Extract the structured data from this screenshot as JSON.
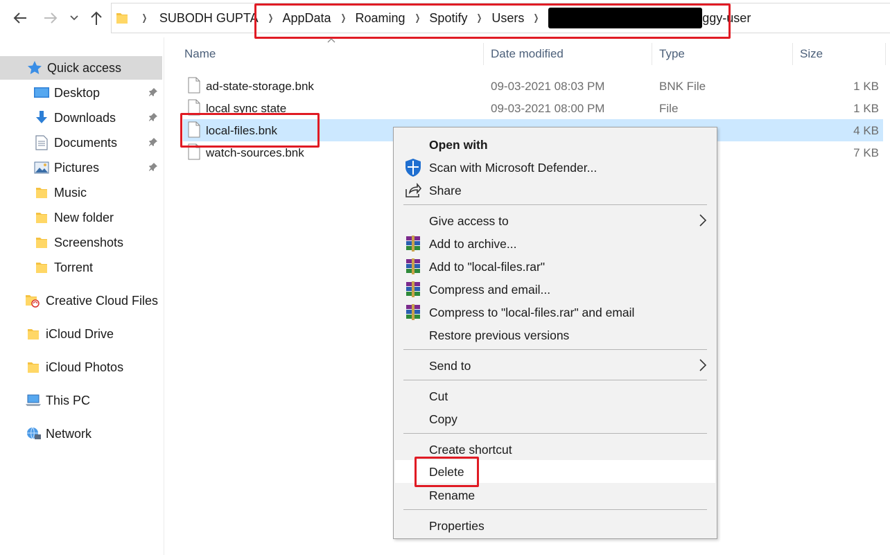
{
  "address_bar": {
    "crumbs": [
      "SUBODH GUPTA",
      "AppData",
      "Roaming",
      "Spotify",
      "Users"
    ],
    "last_crumb_visible": "ggy-user"
  },
  "sidebar": {
    "quick_access": "Quick access",
    "pinned": [
      "Desktop",
      "Downloads",
      "Documents",
      "Pictures"
    ],
    "folders": [
      "Music",
      "New folder",
      "Screenshots",
      "Torrent"
    ],
    "creative_cloud": "Creative Cloud Files",
    "icloud_drive": "iCloud Drive",
    "icloud_photos": "iCloud Photos",
    "this_pc": "This PC",
    "network": "Network"
  },
  "columns": {
    "name": "Name",
    "date": "Date modified",
    "type": "Type",
    "size": "Size"
  },
  "files": [
    {
      "name": "ad-state-storage.bnk",
      "date": "09-03-2021 08:03 PM",
      "type": "BNK File",
      "size": "1 KB"
    },
    {
      "name": "local sync state",
      "date": "09-03-2021 08:00 PM",
      "type": "File",
      "size": "1 KB"
    },
    {
      "name": "local-files.bnk",
      "date": "",
      "type": "",
      "size": "4 KB"
    },
    {
      "name": "watch-sources.bnk",
      "date": "",
      "type": "",
      "size": "7 KB"
    }
  ],
  "context_menu": {
    "open_with": "Open with",
    "scan": "Scan with Microsoft Defender...",
    "share": "Share",
    "give_access": "Give access to",
    "add_archive": "Add to archive...",
    "add_rar": "Add to \"local-files.rar\"",
    "compress_email": "Compress and email...",
    "compress_rar_email": "Compress to \"local-files.rar\" and email",
    "restore": "Restore previous versions",
    "send_to": "Send to",
    "cut": "Cut",
    "copy": "Copy",
    "create_shortcut": "Create shortcut",
    "delete": "Delete",
    "rename": "Rename",
    "properties": "Properties"
  },
  "colors": {
    "selection": "#cce8ff",
    "sidebar_selected": "#d9d9d9",
    "highlight_box": "#e01b24",
    "menu_bg": "#f2f2f2"
  }
}
